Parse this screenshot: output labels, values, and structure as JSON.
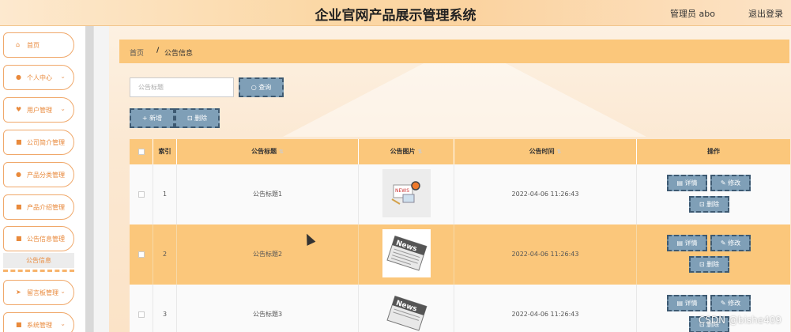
{
  "header": {
    "title": "企业官网产品展示管理系统",
    "user": "管理员 abo",
    "logout": "退出登录"
  },
  "sidebar": {
    "items": [
      {
        "label": "首页",
        "icon": "home-icon",
        "glyph": "⌂"
      },
      {
        "label": "个人中心",
        "icon": "user-icon",
        "glyph": "●"
      },
      {
        "label": "用户管理",
        "icon": "shield-icon",
        "glyph": "♥"
      },
      {
        "label": "公司简介管理",
        "icon": "grid-icon",
        "glyph": "■"
      },
      {
        "label": "产品分类管理",
        "icon": "user-icon",
        "glyph": "●"
      },
      {
        "label": "产品介绍管理",
        "icon": "grid-icon",
        "glyph": "■"
      },
      {
        "label": "公告信息管理",
        "icon": "grid-icon",
        "glyph": "■"
      },
      {
        "label": "留言板管理",
        "icon": "send-icon",
        "glyph": "➤"
      },
      {
        "label": "系统管理",
        "icon": "grid-icon",
        "glyph": "■"
      }
    ],
    "sub_item": "公告信息"
  },
  "breadcrumb": {
    "home": "首页",
    "separator": "/",
    "current": "公告信息"
  },
  "search": {
    "placeholder": "公告标题",
    "button": "查询"
  },
  "toolbar": {
    "add": "新增",
    "delete": "删除"
  },
  "table": {
    "headers": {
      "index": "索引",
      "title": "公告标题",
      "image": "公告图片",
      "time": "公告时间",
      "actions": "操作"
    },
    "rows": [
      {
        "index": "1",
        "title": "公告标题1",
        "time": "2022-04-06 11:26:43"
      },
      {
        "index": "2",
        "title": "公告标题2",
        "time": "2022-04-06 11:26:43"
      },
      {
        "index": "3",
        "title": "公告标题3",
        "time": "2022-04-06 11:26:43"
      }
    ],
    "action_labels": {
      "detail": "详情",
      "edit": "修改",
      "delete": "删除"
    }
  },
  "watermark": "CSDN @bishe409",
  "colors": {
    "accent": "#fbc77b",
    "button": "#7f9fb7",
    "sidebar_text": "#e98a3c"
  }
}
